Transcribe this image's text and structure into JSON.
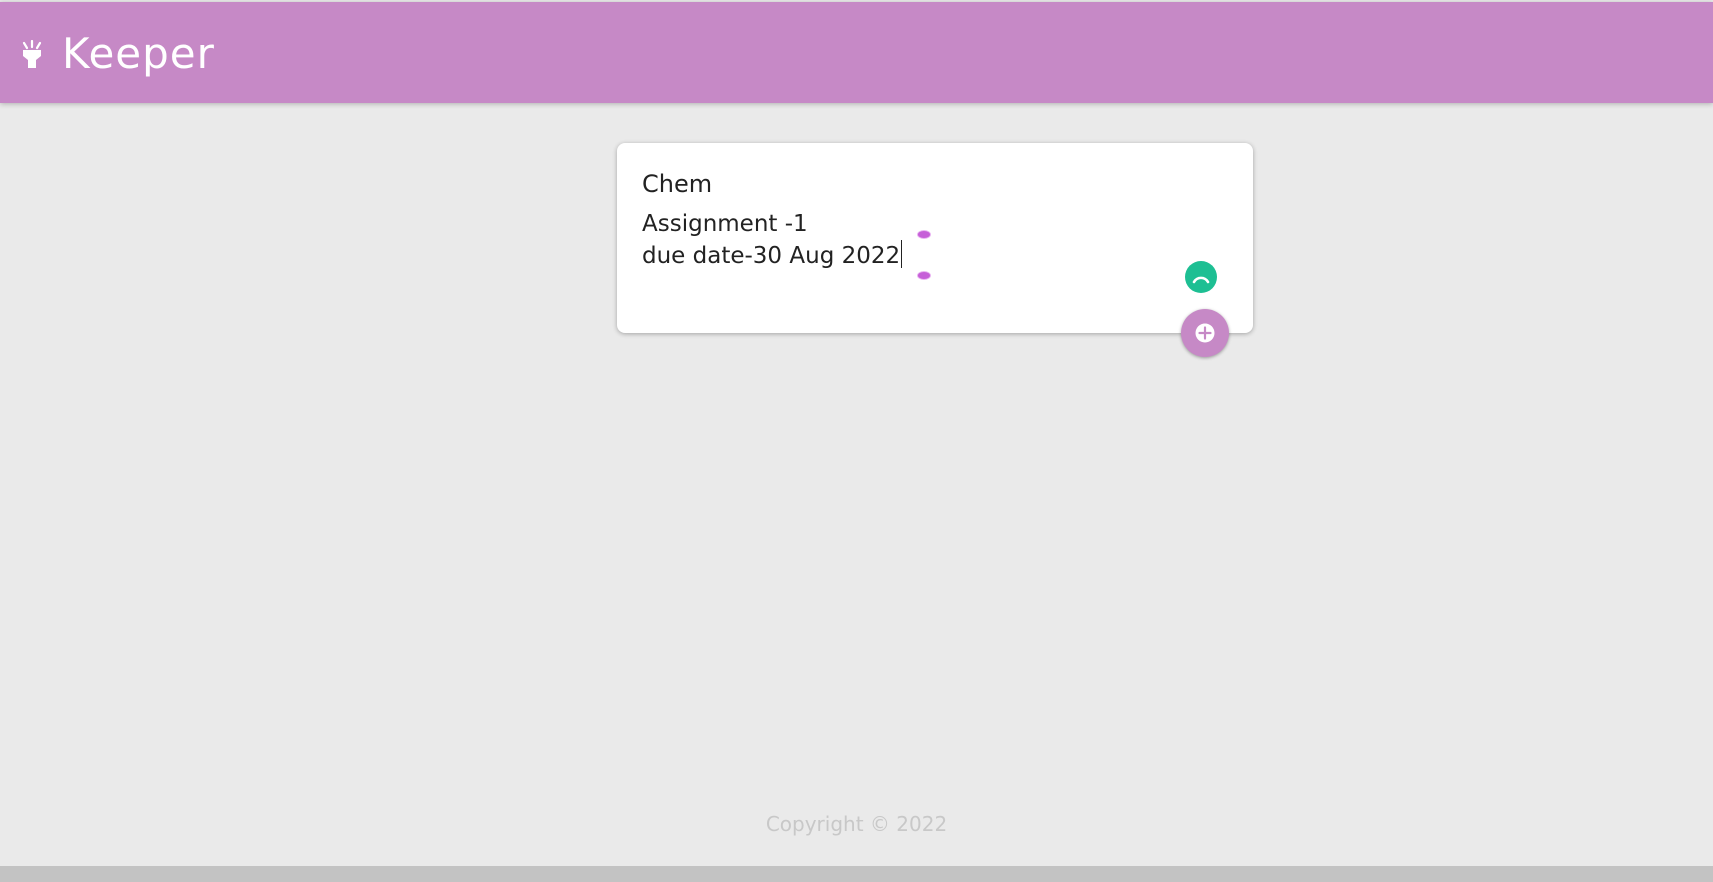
{
  "header": {
    "app_title": "Keeper",
    "logo_icon": "flashlight-icon",
    "background_color": "#c689c6"
  },
  "note_form": {
    "title_value": "Chem",
    "content_lines": [
      "Assignment -1",
      "due date-30 Aug 2022"
    ],
    "add_icon": "plus-circle-icon",
    "grammar_icon": "grammar-assistant-icon",
    "grammar_color": "#1dbf93"
  },
  "footer": {
    "copyright": "Copyright © 2022"
  }
}
